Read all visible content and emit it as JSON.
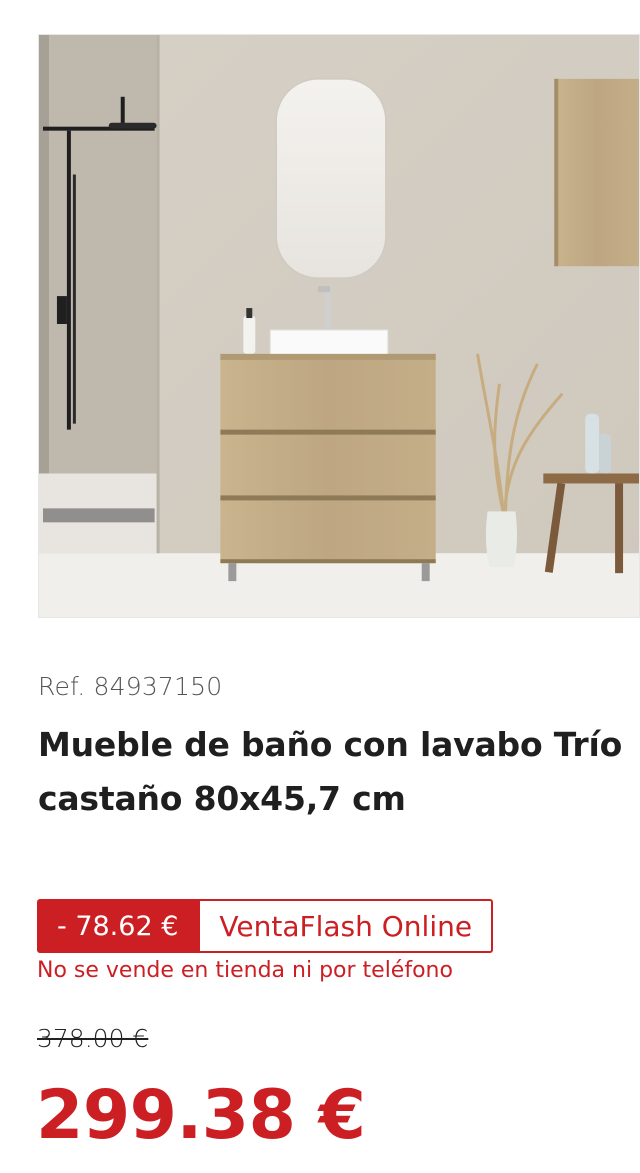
{
  "product": {
    "image_alt": "",
    "reference": "Ref. 84937150",
    "title": "Mueble de baño con lavabo Trío castaño 80x45,7 cm"
  },
  "promotion": {
    "discount": "- 78.62 €",
    "label": "VentaFlash Online",
    "notice": "No se vende en tienda ni por teléfono"
  },
  "pricing": {
    "old_price": "378.00 €",
    "current_price": "299.38 €"
  },
  "colors": {
    "accent_red": "#cc1f24",
    "text": "#1f1f1f"
  }
}
